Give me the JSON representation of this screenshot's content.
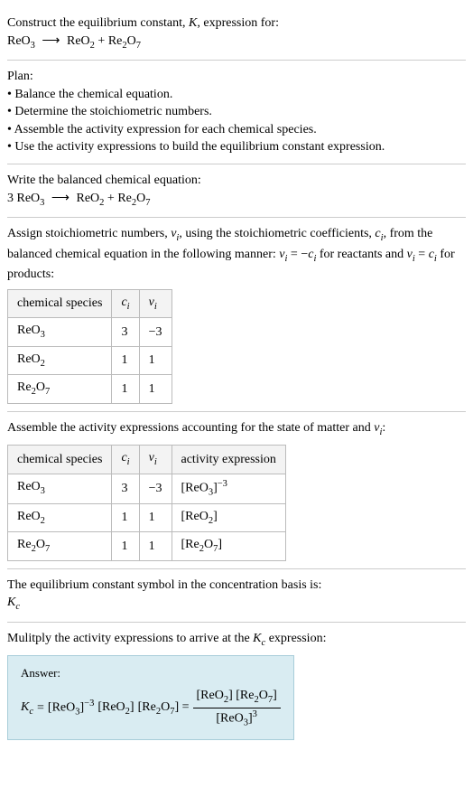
{
  "header": {
    "prompt": "Construct the equilibrium constant, ",
    "Kvar": "K",
    "prompt2": ", expression for:"
  },
  "reaction_unbalanced": {
    "lhs": "ReO",
    "lhs_sub": "3",
    "arrow": "⟶",
    "rhs1": "ReO",
    "rhs1_sub": "2",
    "plus": " + ",
    "rhs2": "Re",
    "rhs2_sub1": "2",
    "rhs2_o": "O",
    "rhs2_sub2": "7"
  },
  "plan": {
    "title": "Plan:",
    "b1": "• Balance the chemical equation.",
    "b2": "• Determine the stoichiometric numbers.",
    "b3": "• Assemble the activity expression for each chemical species.",
    "b4": "• Use the activity expressions to build the equilibrium constant expression."
  },
  "balanced_intro": "Write the balanced chemical equation:",
  "reaction_balanced": {
    "coef": "3 ",
    "lhs": "ReO",
    "lhs_sub": "3",
    "arrow": "⟶",
    "rhs1": "ReO",
    "rhs1_sub": "2",
    "plus": " + ",
    "rhs2": "Re",
    "rhs2_sub1": "2",
    "rhs2_o": "O",
    "rhs2_sub2": "7"
  },
  "stoich": {
    "intro1": "Assign stoichiometric numbers, ",
    "nu": "ν",
    "sub_i": "i",
    "intro2": ", using the stoichiometric coefficients, ",
    "c": "c",
    "intro3": ", from the balanced chemical equation in the following manner: ",
    "eq1a": "ν",
    "eq1b": " = −",
    "eq1c": "c",
    "intro4": " for reactants and ",
    "eq2a": "ν",
    "eq2b": " = ",
    "eq2c": "c",
    "intro5": " for products:"
  },
  "table1": {
    "h1": "chemical species",
    "h2c": "c",
    "h2i": "i",
    "h3n": "ν",
    "h3i": "i",
    "r1s": "ReO",
    "r1sub": "3",
    "r1c": "3",
    "r1n": "−3",
    "r2s": "ReO",
    "r2sub": "2",
    "r2c": "1",
    "r2n": "1",
    "r3s": "Re",
    "r3sub1": "2",
    "r3o": "O",
    "r3sub2": "7",
    "r3c": "1",
    "r3n": "1"
  },
  "activity_intro1": "Assemble the activity expressions accounting for the state of matter and ",
  "activity_nu": "ν",
  "activity_i": "i",
  "activity_intro2": ":",
  "table2": {
    "h1": "chemical species",
    "h2c": "c",
    "h2i": "i",
    "h3n": "ν",
    "h3i": "i",
    "h4": "activity expression",
    "r1s": "ReO",
    "r1sub": "3",
    "r1c": "3",
    "r1n": "−3",
    "r1a_l": "[ReO",
    "r1a_sub": "3",
    "r1a_r": "]",
    "r1a_exp": "−3",
    "r2s": "ReO",
    "r2sub": "2",
    "r2c": "1",
    "r2n": "1",
    "r2a_l": "[ReO",
    "r2a_sub": "2",
    "r2a_r": "]",
    "r3s": "Re",
    "r3sub1": "2",
    "r3o": "O",
    "r3sub2": "7",
    "r3c": "1",
    "r3n": "1",
    "r3a_l": "[Re",
    "r3a_sub1": "2",
    "r3a_o": "O",
    "r3a_sub2": "7",
    "r3a_r": "]"
  },
  "basis": {
    "line1": "The equilibrium constant symbol in the concentration basis is:",
    "K": "K",
    "c": "c"
  },
  "multiply": {
    "line": "Mulitply the activity expressions to arrive at the ",
    "K": "K",
    "c": "c",
    "line2": " expression:"
  },
  "answer": {
    "label": "Answer:",
    "K": "K",
    "c": "c",
    "eq": " = ",
    "t1": "[ReO",
    "t1s": "3",
    "t1r": "]",
    "t1e": "−3",
    "sp": " ",
    "t2": "[ReO",
    "t2s": "2",
    "t2r": "] ",
    "t3": "[Re",
    "t3s1": "2",
    "t3o": "O",
    "t3s2": "7",
    "t3r": "] = ",
    "num1": "[ReO",
    "num1s": "2",
    "num1r": "] [Re",
    "num1s2": "2",
    "num1o": "O",
    "num1s3": "7",
    "num1r2": "]",
    "den1": "[ReO",
    "den1s": "3",
    "den1r": "]",
    "den1e": "3"
  }
}
